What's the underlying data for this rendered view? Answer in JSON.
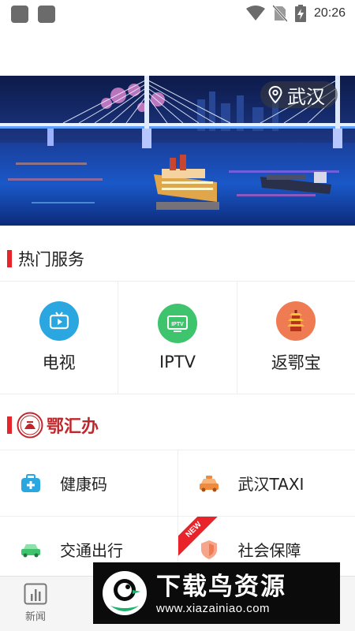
{
  "status_bar": {
    "time": "20:26"
  },
  "banner": {
    "city": "武汉"
  },
  "hot_services": {
    "title": "热门服务",
    "items": [
      {
        "label": "电视",
        "icon": "tv-icon",
        "color": "#2aa7e0"
      },
      {
        "label": "IPTV",
        "icon": "iptv-icon",
        "color": "#3ec46d"
      },
      {
        "label": "返鄂宝",
        "icon": "yellow-crane-tower-icon",
        "color": "#ef7b52"
      }
    ]
  },
  "ehuiban": {
    "title": "鄂汇办",
    "items": [
      {
        "label": "健康码",
        "icon": "medical-kit-icon",
        "color": "#2aa7e0"
      },
      {
        "label": "武汉TAXI",
        "icon": "taxi-icon",
        "color": "#f08a3c"
      },
      {
        "label": "交通出行",
        "icon": "car-icon",
        "color": "#3ec46d"
      },
      {
        "label": "社会保障",
        "icon": "shield-icon",
        "color": "#ef7b52",
        "badge": "NEW"
      }
    ]
  },
  "bottom_nav": {
    "items": [
      {
        "label": "新闻",
        "icon": "news-chart-icon"
      }
    ]
  },
  "watermark": {
    "title": "下载鸟资源",
    "url": "www.xiazainiao.com"
  }
}
